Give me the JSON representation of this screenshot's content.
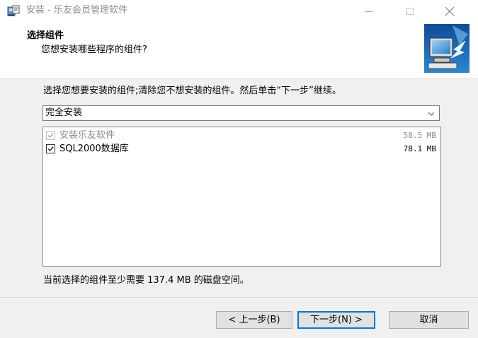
{
  "window": {
    "title": "安装 - 乐友会员管理软件"
  },
  "header": {
    "title": "选择组件",
    "subtitle": "您想安装哪些程序的组件?"
  },
  "content": {
    "instruction": "选择您想要安装的组件;清除您不想安装的组件。然后单击“下一步”继续。",
    "install_type": {
      "selected": "完全安装"
    },
    "components": [
      {
        "name": "安装乐友软件",
        "size": "58.5 MB",
        "checked": true,
        "disabled": true
      },
      {
        "name": "SQL2000数据库",
        "size": "78.1 MB",
        "checked": true,
        "disabled": false
      }
    ],
    "space_note": "当前选择的组件至少需要 137.4 MB 的磁盘空间。"
  },
  "buttons": {
    "back": "< 上一步(B)",
    "next": "下一步(N) >",
    "cancel": "取消"
  },
  "colors": {
    "accent": "#0078d7",
    "content_bg": "#f0f0f0",
    "disabled_text": "#8a8a8a"
  }
}
